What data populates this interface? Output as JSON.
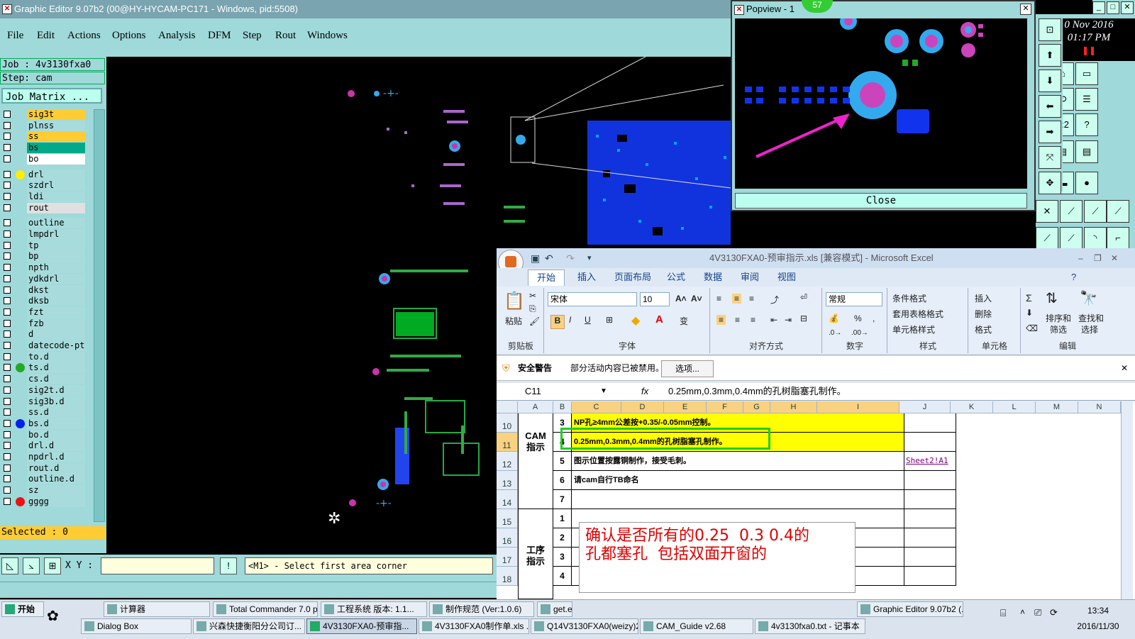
{
  "genesis": {
    "title": "Graphic Editor 9.07b2 (00@HY-HYCAM-PC171 - Windows, pid:5508)",
    "menu": [
      "File",
      "Edit",
      "Actions",
      "Options",
      "Analysis",
      "DFM",
      "Step",
      "Rout",
      "Windows"
    ],
    "job": "Job : 4v3130fxa0",
    "step": "Step: cam",
    "job_matrix": "Job Matrix ...",
    "layers": [
      {
        "name": "sig3t",
        "bg": "#ffcc33",
        "dot": ""
      },
      {
        "name": "plnss",
        "bg": "#a8dcdc",
        "dot": ""
      },
      {
        "name": "ss",
        "bg": "#ffcc33",
        "dot": ""
      },
      {
        "name": "bs",
        "bg": "#00aa88",
        "dot": ""
      },
      {
        "name": "bo",
        "bg": "#ffffff",
        "dot": ""
      },
      {
        "name": "drl",
        "bg": "#a8dcdc",
        "dot": "#ffee00"
      },
      {
        "name": "szdrl",
        "bg": "#a8dcdc",
        "dot": ""
      },
      {
        "name": "ldi",
        "bg": "#a8dcdc",
        "dot": ""
      },
      {
        "name": "rout",
        "bg": "#e0e0e0",
        "dot": ""
      },
      {
        "name": "outline",
        "bg": "#a8dcdc",
        "dot": ""
      },
      {
        "name": "lmpdrl",
        "bg": "#a8dcdc",
        "dot": ""
      },
      {
        "name": "tp",
        "bg": "#a8dcdc",
        "dot": ""
      },
      {
        "name": "bp",
        "bg": "#a8dcdc",
        "dot": ""
      },
      {
        "name": "npth",
        "bg": "#a8dcdc",
        "dot": ""
      },
      {
        "name": "ydkdrl",
        "bg": "#a8dcdc",
        "dot": ""
      },
      {
        "name": "dkst",
        "bg": "#a8dcdc",
        "dot": ""
      },
      {
        "name": "dksb",
        "bg": "#a8dcdc",
        "dot": ""
      },
      {
        "name": "fzt",
        "bg": "#a8dcdc",
        "dot": ""
      },
      {
        "name": "fzb",
        "bg": "#a8dcdc",
        "dot": ""
      },
      {
        "name": "d",
        "bg": "#a8dcdc",
        "dot": ""
      },
      {
        "name": "datecode-pt",
        "bg": "#a8dcdc",
        "dot": ""
      },
      {
        "name": "to.d",
        "bg": "#a8dcdc",
        "dot": ""
      },
      {
        "name": "ts.d",
        "bg": "#a8dcdc",
        "dot": "#22aa22"
      },
      {
        "name": "cs.d",
        "bg": "#a8dcdc",
        "dot": ""
      },
      {
        "name": "sig2t.d",
        "bg": "#a8dcdc",
        "dot": ""
      },
      {
        "name": "sig3b.d",
        "bg": "#a8dcdc",
        "dot": ""
      },
      {
        "name": "ss.d",
        "bg": "#a8dcdc",
        "dot": ""
      },
      {
        "name": "bs.d",
        "bg": "#a8dcdc",
        "dot": "#0022ee"
      },
      {
        "name": "bo.d",
        "bg": "#a8dcdc",
        "dot": ""
      },
      {
        "name": "drl.d",
        "bg": "#a8dcdc",
        "dot": ""
      },
      {
        "name": "npdrl.d",
        "bg": "#a8dcdc",
        "dot": ""
      },
      {
        "name": "rout.d",
        "bg": "#a8dcdc",
        "dot": ""
      },
      {
        "name": "outline.d",
        "bg": "#a8dcdc",
        "dot": ""
      },
      {
        "name": "sz",
        "bg": "#a8dcdc",
        "dot": ""
      },
      {
        "name": "gggg",
        "bg": "#a8dcdc",
        "dot": "#ee1111"
      }
    ],
    "selected": "Selected : 0",
    "xy_label": "X Y :",
    "prompt": "<M1> - Select first area corner"
  },
  "popview": {
    "title": "Popview - 1",
    "close": "Close",
    "badge": "57"
  },
  "clock_panel": {
    "date": "0 Nov 2016",
    "time": "01:17 PM"
  },
  "excel": {
    "title": "4V3130FXA0-预审指示.xls  [兼容模式] - Microsoft Excel",
    "tabs": [
      "开始",
      "插入",
      "页面布局",
      "公式",
      "数据",
      "审阅",
      "视图"
    ],
    "ribbon": {
      "paste": "粘贴",
      "font_name": "宋体",
      "font_size": "10",
      "number_format": "常规",
      "groups": [
        "剪贴板",
        "字体",
        "对齐方式",
        "数字",
        "样式",
        "单元格",
        "编辑"
      ],
      "styles": [
        "条件格式",
        "套用表格格式",
        "单元格样式"
      ],
      "cells": [
        "插入",
        "删除",
        "格式"
      ],
      "edit": [
        "排序和",
        "筛选",
        "查找和",
        "选择"
      ]
    },
    "warning_title": "安全警告",
    "warning_text": "部分活动内容已被禁用。",
    "warning_button": "选项...",
    "name_box": "C11",
    "formula": "0.25mm,0.3mm,0.4mm的孔树脂塞孔制作。",
    "columns": [
      "A",
      "B",
      "C",
      "D",
      "E",
      "F",
      "G",
      "H",
      "I",
      "J",
      "K",
      "L",
      "M",
      "N"
    ],
    "rows": [
      "10",
      "11",
      "12",
      "13",
      "14",
      "15",
      "16",
      "17",
      "18"
    ],
    "section_cam": "CAM\n指示",
    "section_process": "工序\n指示",
    "cam_items": [
      {
        "num": "3",
        "text": "NP孔≥4mm公差按+0.35/-0.05mm控制。"
      },
      {
        "num": "4",
        "text": "0.25mm,0.3mm,0.4mm的孔树脂塞孔制作。"
      },
      {
        "num": "5",
        "text": "图示位置按露铜制作，接受毛刺。"
      },
      {
        "num": "6",
        "text": "请cam自行TB命名"
      },
      {
        "num": "7",
        "text": ""
      }
    ],
    "process_nums": [
      "1",
      "2",
      "3",
      "4"
    ],
    "link": "Sheet2!A1",
    "annotation": "确认是否所有的0.25  0.3 0.4的\n孔都塞孔  包括双面开窗的"
  },
  "taskbar": {
    "start": "开始",
    "row1": [
      {
        "label": "计算器"
      },
      {
        "label": "Total Commander 7.0 p..."
      },
      {
        "label": "工程系统  版本: 1.1..."
      },
      {
        "label": "制作规范 (Ver:1.0.6)"
      },
      {
        "label": "get.e"
      },
      {
        "label": "Graphic Editor 9.07b2 (..."
      }
    ],
    "row2": [
      {
        "label": "Dialog Box"
      },
      {
        "label": "兴森快捷衡阳分公司订..."
      },
      {
        "label": "4V3130FXA0-预审指..."
      },
      {
        "label": "4V3130FXA0制作单.xls ..."
      },
      {
        "label": "Q14V3130FXA0(weizy)2..."
      },
      {
        "label": "CAM_Guide v2.68"
      },
      {
        "label": "4v3130fxa0.txt - 记事本"
      }
    ],
    "time": "13:34",
    "date": "2016/11/30"
  },
  "colors": {
    "genesis_bg": "#9fd9d9",
    "layer_highlight": "#ffcc33",
    "excel_yellow": "#ffff00",
    "annotation_red": "#dd0000",
    "selection_green": "#22cc22"
  }
}
